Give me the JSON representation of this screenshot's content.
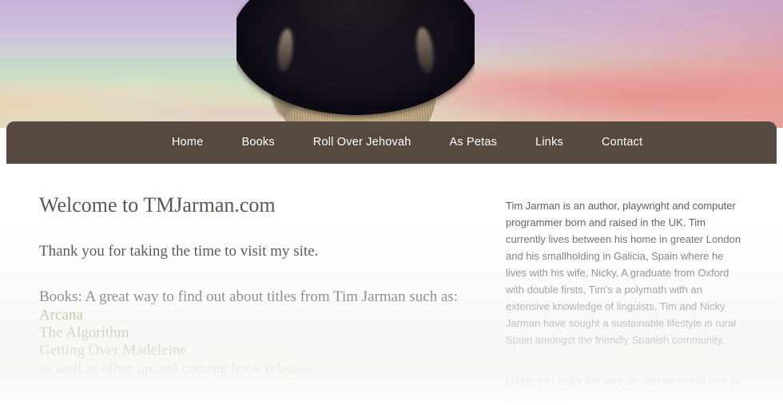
{
  "site": {
    "title": "TMJarman.com"
  },
  "hero": {
    "image_alt": "Portrait of a bearded man in a wide-brimmed black hat and round sunglasses against a pastel sunset sky",
    "sky_colors": {
      "top_lavender": "#cdbcdd",
      "mid_mint": "#c9ddc6",
      "bottom_warm": "#e4dabd",
      "cloud_pink": "#e88888"
    }
  },
  "nav": {
    "background": "#564a40",
    "text_color": "#ffffff",
    "items": [
      {
        "label": "Home"
      },
      {
        "label": "Books"
      },
      {
        "label": "Roll Over Jehovah"
      },
      {
        "label": "As Petas"
      },
      {
        "label": "Links"
      },
      {
        "label": "Contact"
      }
    ]
  },
  "main": {
    "heading": "Welcome to TMJarman.com",
    "heading_color": "#5b564f",
    "intro": "Thank you for taking the time to visit my site.",
    "books_intro": "Books: A great way to find out about titles from Tim Jarman such as:",
    "book_link_color": "#7d8a5c",
    "books": [
      {
        "label": "Arcana"
      },
      {
        "label": "The Algorithm"
      },
      {
        "label": "Getting Over Madeleine"
      }
    ],
    "books_tail": "as well as other up and coming book releases."
  },
  "sidebar": {
    "bio": "Tim Jarman is an author, playwright and computer programmer born and raised in the UK. Tim currently lives between his home in greater London and his smallholding in Galicia, Spain where he lives with his wife, Nicky. A graduate from Oxford with double firsts, Tim's a polymath with an extensive knowledge of linguists. Tim and Nicky Jarman have sought a sustainable lifestyle in rural Spain amongst the friendly Spanish community.",
    "closing": "I hope you enjoy this website and we would love to hear from you."
  }
}
